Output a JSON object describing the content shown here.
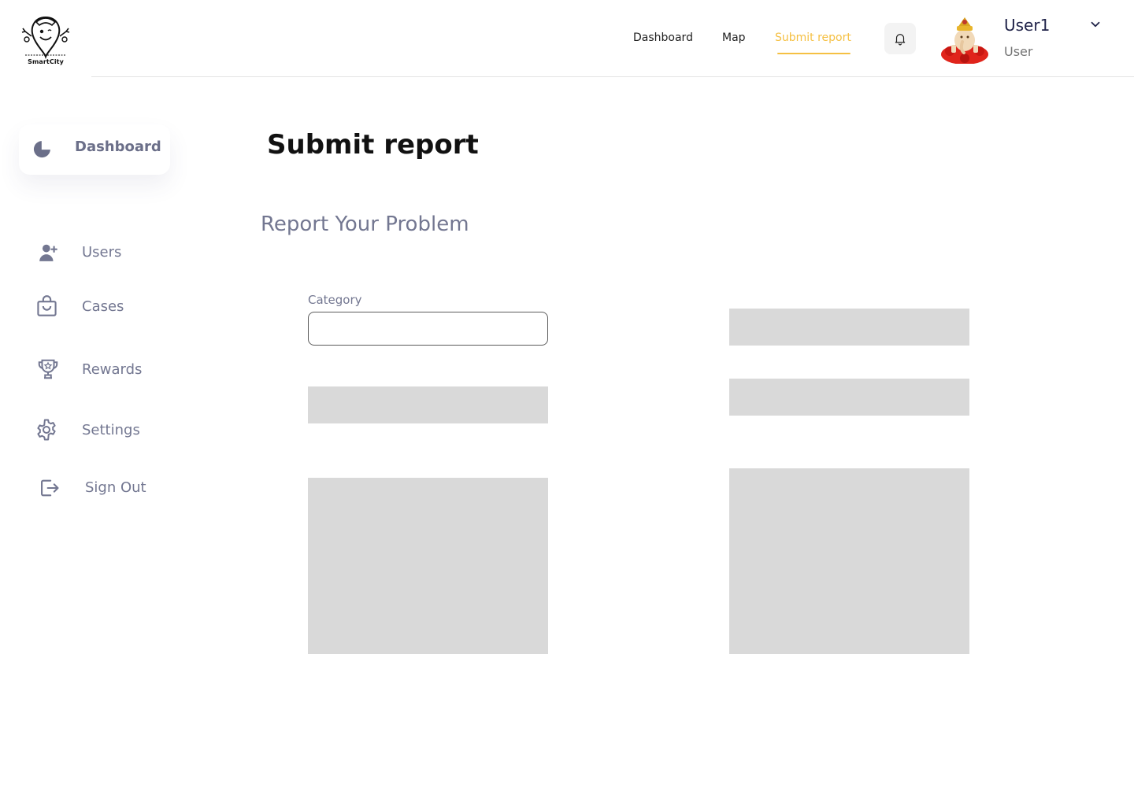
{
  "app": {
    "logo_text": "SmartCity"
  },
  "topnav": {
    "items": [
      {
        "label": "Dashboard",
        "active": false
      },
      {
        "label": "Map",
        "active": false
      },
      {
        "label": "Submit report",
        "active": true
      }
    ]
  },
  "user": {
    "name": "User1",
    "role": "User"
  },
  "sidebar": {
    "items": [
      {
        "label": "Dashboard",
        "icon": "pie-chart-icon",
        "active": true
      },
      {
        "label": "Users",
        "icon": "user-add-icon"
      },
      {
        "label": "Cases",
        "icon": "shopping-bag-icon"
      },
      {
        "label": "Rewards",
        "icon": "trophy-icon"
      },
      {
        "label": "Settings",
        "icon": "gear-icon"
      },
      {
        "label": "Sign Out",
        "icon": "sign-out-icon"
      }
    ]
  },
  "main": {
    "title": "Submit report",
    "section_title": "Report Your Problem",
    "form": {
      "category_label": "Category",
      "category_value": ""
    }
  },
  "colors": {
    "accent": "#f5c043",
    "muted_text": "#737791",
    "placeholder_block": "#d9d9d9"
  }
}
